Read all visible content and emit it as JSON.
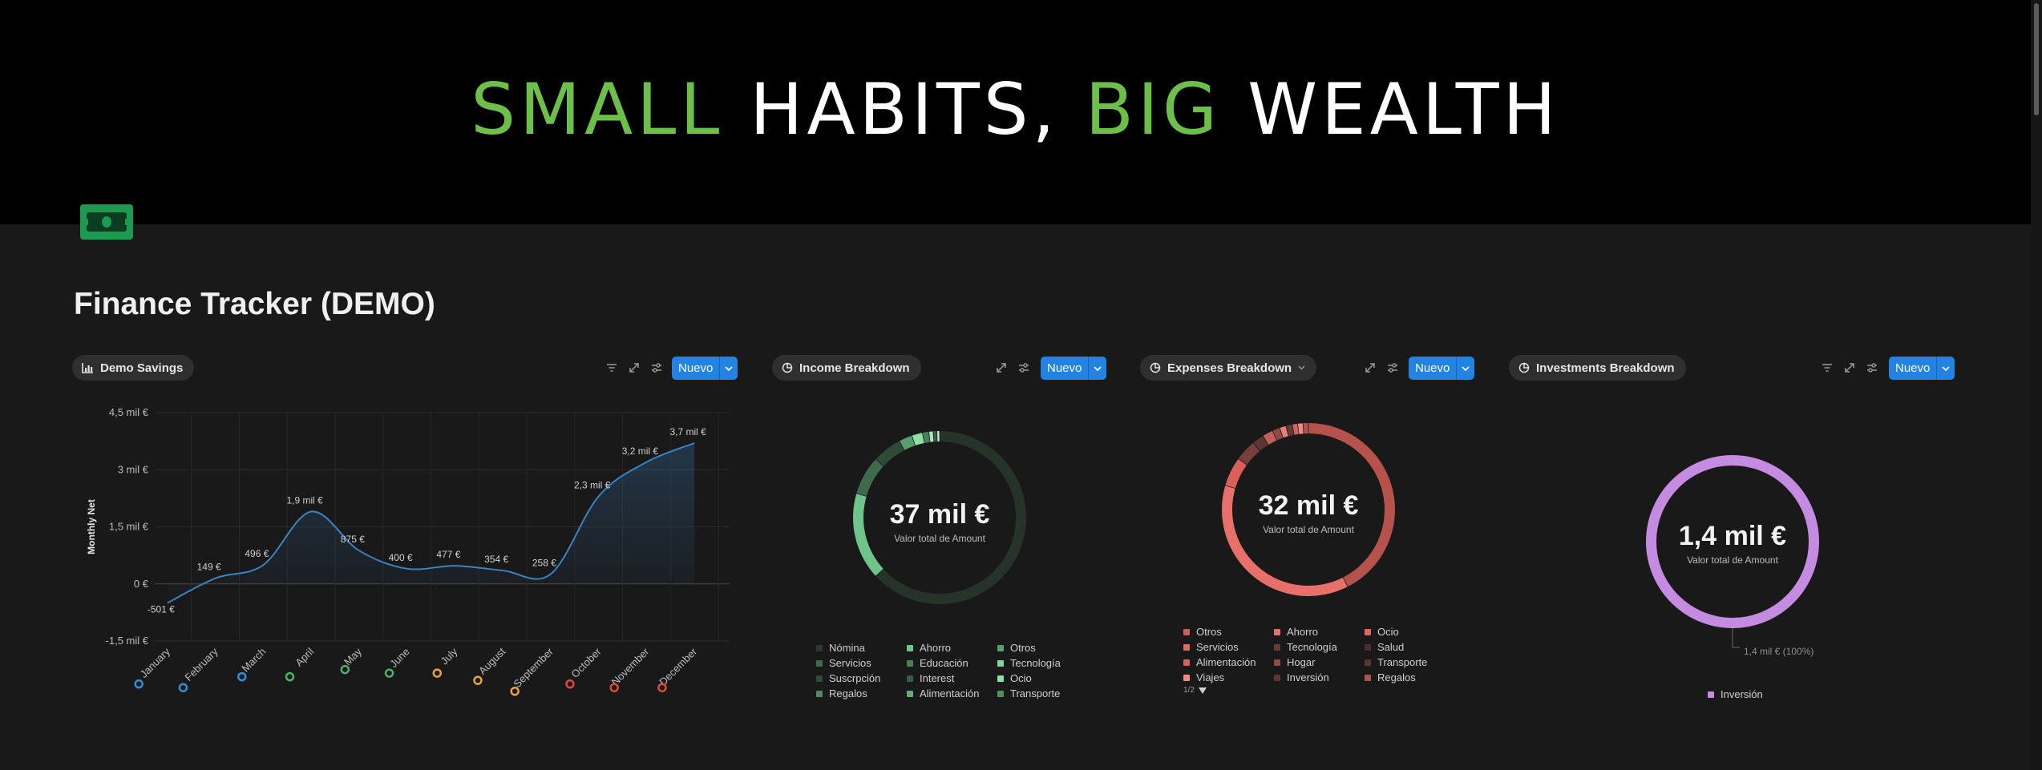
{
  "banner": {
    "word1": "SMALL",
    "word2": "HABITS,",
    "word3": "BIG",
    "word4": "WEALTH"
  },
  "page": {
    "title": "Finance Tracker (DEMO)"
  },
  "new_button_label": "Nuevo",
  "savings": {
    "tab_label": "Demo Savings",
    "chart_data": {
      "type": "line",
      "title": "",
      "xlabel": "",
      "ylabel": "Monthly Net",
      "categories": [
        "January",
        "February",
        "March",
        "April",
        "May",
        "June",
        "July",
        "August",
        "September",
        "October",
        "November",
        "December"
      ],
      "values": [
        -501,
        149,
        496,
        1900,
        875,
        400,
        477,
        354,
        258,
        2300,
        3200,
        3700
      ],
      "data_labels": [
        "-501 €",
        "149 €",
        "496 €",
        "1,9 mil €",
        "875 €",
        "400 €",
        "477 €",
        "354 €",
        "258 €",
        "2,3 mil €",
        "3,2 mil €",
        "3,7 mil €"
      ],
      "y_ticks": [
        {
          "v": 4500,
          "label": "4,5 mil €"
        },
        {
          "v": 3000,
          "label": "3 mil €"
        },
        {
          "v": 1500,
          "label": "1,5 mil €"
        },
        {
          "v": 0,
          "label": "0 €"
        },
        {
          "v": -1500,
          "label": "-1,5 mil €"
        }
      ],
      "ylim": [
        -1500,
        4500
      ],
      "grid": true,
      "marker_colors": [
        "#2f8fd9",
        "#2f8fd9",
        "#2f8fd9",
        "#4caf6a",
        "#4caf6a",
        "#4caf6a",
        "#e8a33c",
        "#e8a33c",
        "#e8a33c",
        "#e0483f",
        "#e0483f",
        "#e0483f"
      ],
      "line_color": "#3b82c4"
    }
  },
  "income": {
    "tab_label": "Income Breakdown",
    "center_value": "37 mil €",
    "center_label": "Valor total de Amount",
    "chart_data": {
      "type": "pie",
      "donut": true,
      "values_pct": [
        63.2,
        16.3,
        7.3,
        5.5,
        2.5,
        2.0,
        1.2,
        0.8,
        0.7,
        0.5
      ],
      "colors": [
        "#263329",
        "#6ec48a",
        "#3e6b4b",
        "#2f4a36",
        "#5a9d6d",
        "#8de0a4",
        "#4b7f5a",
        "#a8e6b8",
        "#3a5c44",
        "#c7f0d2"
      ]
    },
    "legend": [
      {
        "label": "Nómina",
        "color": "#2b3a2f"
      },
      {
        "label": "Ahorro",
        "color": "#6ec48a"
      },
      {
        "label": "Otros",
        "color": "#5a9d6d"
      },
      {
        "label": "Servicios",
        "color": "#3e6b4b"
      },
      {
        "label": "Educación",
        "color": "#4b7f5a"
      },
      {
        "label": "Tecnología",
        "color": "#7fd69a"
      },
      {
        "label": "Suscrpción",
        "color": "#2f4a36"
      },
      {
        "label": "Interest",
        "color": "#3a5c44"
      },
      {
        "label": "Ocio",
        "color": "#8de0a4"
      },
      {
        "label": "Regalos",
        "color": "#4e8a60"
      },
      {
        "label": "Alimentación",
        "color": "#5fae77"
      },
      {
        "label": "Transporte",
        "color": "#4c9363"
      }
    ]
  },
  "expenses": {
    "tab_label": "Expenses Breakdown",
    "center_value": "32 mil €",
    "center_label": "Valor total de Amount",
    "chart_data": {
      "type": "pie",
      "donut": true,
      "values_pct": [
        42.5,
        37.0,
        5.5,
        4.0,
        2.2,
        2.0,
        1.4,
        1.2,
        1.2,
        1.0,
        1.0,
        1.0
      ],
      "colors": [
        "#b5524c",
        "#e8706a",
        "#d95f59",
        "#7a3f3c",
        "#5c3432",
        "#c0605a",
        "#8f4a46",
        "#e87f79",
        "#6a3a38",
        "#d06660",
        "#f08b84",
        "#a85650"
      ]
    },
    "legend": [
      {
        "label": "Otros",
        "color": "#c9605a"
      },
      {
        "label": "Ahorro",
        "color": "#e8706a"
      },
      {
        "label": "Ocio",
        "color": "#e0665f"
      },
      {
        "label": "Servicios",
        "color": "#e06a63"
      },
      {
        "label": "Tecnología",
        "color": "#6a3a38"
      },
      {
        "label": "Salud",
        "color": "#4a2e2d"
      },
      {
        "label": "Alimentación",
        "color": "#d95f59"
      },
      {
        "label": "Hogar",
        "color": "#8f4a46"
      },
      {
        "label": "Transporte",
        "color": "#5c3432"
      },
      {
        "label": "Viajes",
        "color": "#f08b84"
      },
      {
        "label": "Inversión",
        "color": "#5c3432"
      },
      {
        "label": "Regalos",
        "color": "#a85650"
      }
    ],
    "pager": "1/2"
  },
  "investments": {
    "tab_label": "Investments Breakdown",
    "center_value": "1,4 mil €",
    "center_label": "Valor total de Amount",
    "slice_label": "1,4 mil € (100%)",
    "chart_data": {
      "type": "pie",
      "donut": true,
      "values_pct": [
        100
      ],
      "colors": [
        "#c58be0"
      ]
    },
    "legend": [
      {
        "label": "Inversión",
        "color": "#c58be0"
      }
    ]
  }
}
